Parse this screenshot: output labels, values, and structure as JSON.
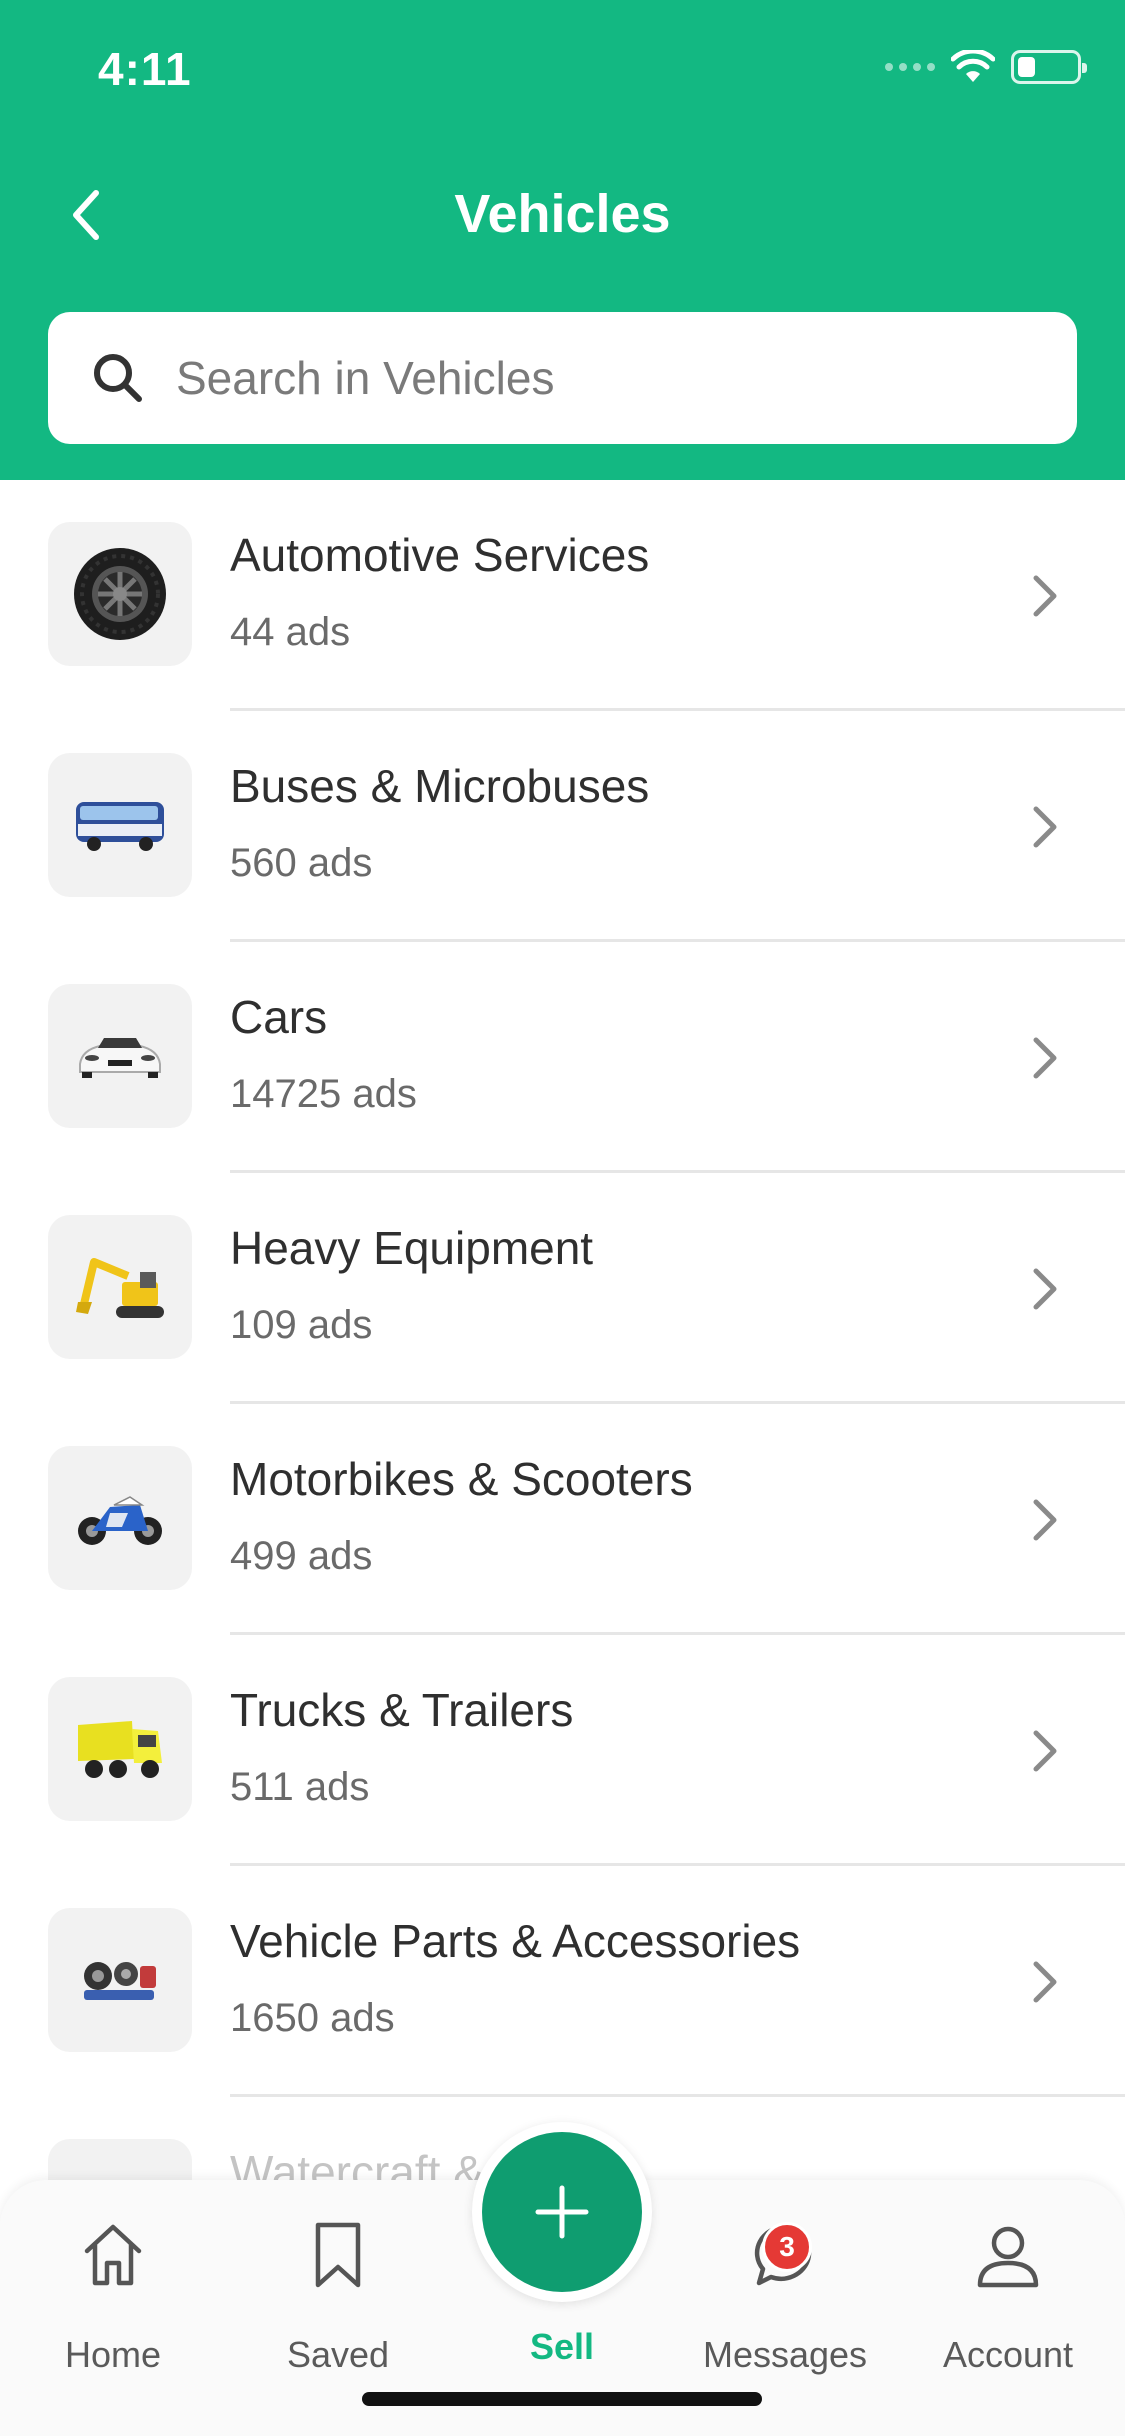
{
  "status_bar": {
    "time": "4:11",
    "battery_level": 0.3
  },
  "header": {
    "title": "Vehicles",
    "back_icon": "chevron-left-icon"
  },
  "search": {
    "placeholder": "Search in Vehicles",
    "value": "",
    "icon": "search-icon"
  },
  "categories": [
    {
      "label": "Automotive Services",
      "count": "44 ads",
      "icon": "tire-icon"
    },
    {
      "label": "Buses & Microbuses",
      "count": "560 ads",
      "icon": "bus-icon"
    },
    {
      "label": "Cars",
      "count": "14725 ads",
      "icon": "car-icon"
    },
    {
      "label": "Heavy Equipment",
      "count": "109 ads",
      "icon": "excavator-icon"
    },
    {
      "label": "Motorbikes & Scooters",
      "count": "499 ads",
      "icon": "motorbike-icon"
    },
    {
      "label": "Trucks & Trailers",
      "count": "511 ads",
      "icon": "truck-icon"
    },
    {
      "label": "Vehicle Parts & Accessories",
      "count": "1650 ads",
      "icon": "parts-icon"
    },
    {
      "label": "Watercraft & Boats",
      "count": "",
      "icon": "boat-icon"
    }
  ],
  "bottom_nav": {
    "home": "Home",
    "saved": "Saved",
    "sell": "Sell",
    "messages": "Messages",
    "messages_badge": "3",
    "account": "Account"
  },
  "colors": {
    "brand": "#13b882",
    "sell": "#0f9d70",
    "badge": "#e53935"
  }
}
